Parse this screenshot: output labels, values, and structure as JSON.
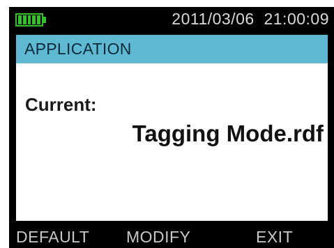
{
  "status_bar": {
    "battery_icon": "battery-full-icon",
    "battery_level": 1.0,
    "battery_color": "#35c12c",
    "datetime": "2011/03/06  21:00:09"
  },
  "title_bar": {
    "title": "APPLICATION",
    "color": "#5fb9d2"
  },
  "content": {
    "current_label": "Current:",
    "current_value": "Tagging Mode.rdf"
  },
  "softkeys": {
    "default_label": "DEFAULT",
    "modify_label": "MODIFY",
    "exit_label": "EXIT"
  }
}
